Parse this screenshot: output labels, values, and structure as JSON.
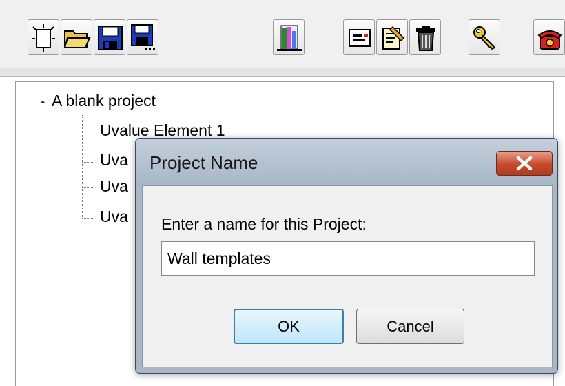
{
  "toolbar": {
    "buttons": [
      {
        "icon": "new-project-icon"
      },
      {
        "icon": "open-folder-icon"
      },
      {
        "icon": "save-icon"
      },
      {
        "icon": "save-as-icon"
      },
      {
        "icon": "report-icon"
      },
      {
        "icon": "window-icon"
      },
      {
        "icon": "edit-document-icon"
      },
      {
        "icon": "trash-icon"
      },
      {
        "icon": "key-icon"
      },
      {
        "icon": "phone-icon"
      }
    ]
  },
  "tree": {
    "root_label": "A blank project",
    "children": [
      {
        "label": "Uvalue Element 1"
      },
      {
        "label": "Uva"
      },
      {
        "label": "Uva"
      },
      {
        "label": "Uva"
      }
    ]
  },
  "dialog": {
    "title": "Project Name",
    "prompt": "Enter a name for this Project:",
    "input_value": "Wall templates",
    "ok_label": "OK",
    "cancel_label": "Cancel"
  },
  "colors": {
    "dialog_frame": "#a9b6c4",
    "close_button": "#c64a2e",
    "ok_border": "#3c7fb1"
  }
}
